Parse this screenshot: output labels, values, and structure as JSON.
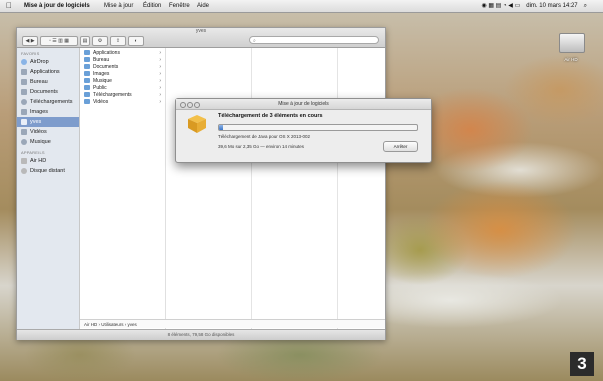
{
  "menubar": {
    "app_name": "Mise à jour de logiciels",
    "menus": [
      "Mise à jour",
      "Édition",
      "Fenêtre",
      "Aide"
    ],
    "datetime": "dim. 10 mars  14:27"
  },
  "finder": {
    "window_title": "yves",
    "search_placeholder": "",
    "sidebar": {
      "favorites_header": "FAVORIS",
      "favorites": [
        "AirDrop",
        "Applications",
        "Bureau",
        "Documents",
        "Téléchargements",
        "Images",
        "yves",
        "Vidéos",
        "Musique"
      ],
      "selected": "yves",
      "devices_header": "APPAREILS",
      "devices": [
        "Air HD",
        "Disque distant"
      ]
    },
    "column_items": [
      "Applications",
      "Bureau",
      "Documents",
      "Images",
      "Musique",
      "Public",
      "Téléchargements",
      "Vidéos"
    ],
    "path": [
      "Air HD",
      "Utilisateurs",
      "yves"
    ],
    "status": "8 éléments, 79,58 Go disponibles"
  },
  "dialog": {
    "title": "Mise à jour de logiciels",
    "heading": "Téléchargement de 3 éléments en cours",
    "progress_fraction": 0.02,
    "subtitle": "Téléchargement de Java pour OS X 2013-002",
    "size_text": "39,6 Mo sur 2,35 Go — environ 14 minutes",
    "stop_label": "Arrêter"
  },
  "desktop": {
    "hd_label": "Air HD",
    "step_number": "3"
  },
  "colors": {
    "selection": "#7e9ccc",
    "progress": "#3d77c8",
    "folder": "#6aa0d8"
  }
}
